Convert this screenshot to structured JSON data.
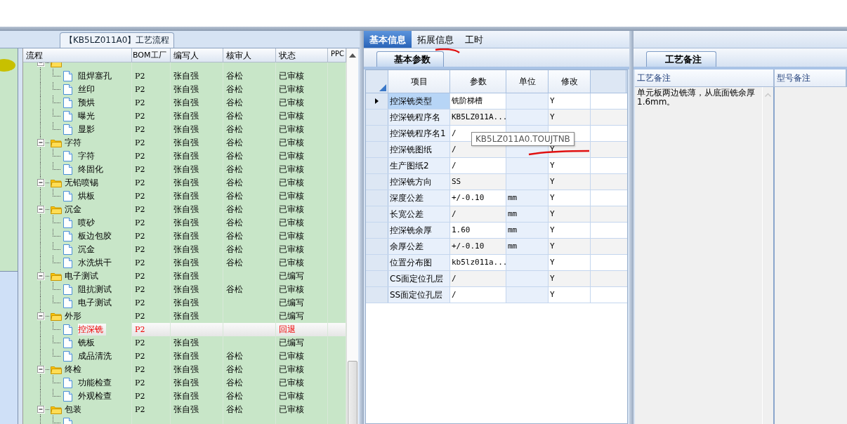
{
  "flow_panel": {
    "title": "【KB5LZ011A0】工艺流程",
    "columns": [
      "流程",
      "BOM工厂",
      "编写人",
      "核审人",
      "状态",
      "PPC"
    ],
    "tree": [
      {
        "selected": false,
        "children": [
          {
            "name": "阻焊塞孔",
            "bom": "P2",
            "writer": "张自强",
            "reviewer": "谷松",
            "status": "已审核",
            "selected": false
          },
          {
            "name": "丝印",
            "bom": "P2",
            "writer": "张自强",
            "reviewer": "谷松",
            "status": "已审核",
            "selected": false
          },
          {
            "name": "预烘",
            "bom": "P2",
            "writer": "张自强",
            "reviewer": "谷松",
            "status": "已审核",
            "selected": false
          },
          {
            "name": "曝光",
            "bom": "P2",
            "writer": "张自强",
            "reviewer": "谷松",
            "status": "已审核",
            "selected": false
          },
          {
            "name": "显影",
            "bom": "P2",
            "writer": "张自强",
            "reviewer": "谷松",
            "status": "已审核",
            "selected": false
          }
        ]
      },
      {
        "name": "字符",
        "bom": "P2",
        "writer": "张自强",
        "reviewer": "谷松",
        "status": "已审核",
        "selected": false,
        "children": [
          {
            "name": "字符",
            "bom": "P2",
            "writer": "张自强",
            "reviewer": "谷松",
            "status": "已审核",
            "selected": false
          },
          {
            "name": "终固化",
            "bom": "P2",
            "writer": "张自强",
            "reviewer": "谷松",
            "status": "已审核",
            "selected": false
          }
        ]
      },
      {
        "name": "无铅喷锡",
        "bom": "P2",
        "writer": "张自强",
        "reviewer": "谷松",
        "status": "已审核",
        "selected": false,
        "children": [
          {
            "name": "烘板",
            "bom": "P2",
            "writer": "张自强",
            "reviewer": "谷松",
            "status": "已审核",
            "selected": false
          }
        ]
      },
      {
        "name": "沉金",
        "bom": "P2",
        "writer": "张自强",
        "reviewer": "谷松",
        "status": "已审核",
        "selected": false,
        "children": [
          {
            "name": "喷砂",
            "bom": "P2",
            "writer": "张自强",
            "reviewer": "谷松",
            "status": "已审核",
            "selected": false
          },
          {
            "name": "板边包胶",
            "bom": "P2",
            "writer": "张自强",
            "reviewer": "谷松",
            "status": "已审核",
            "selected": false
          },
          {
            "name": "沉金",
            "bom": "P2",
            "writer": "张自强",
            "reviewer": "谷松",
            "status": "已审核",
            "selected": false
          },
          {
            "name": "水洗烘干",
            "bom": "P2",
            "writer": "张自强",
            "reviewer": "谷松",
            "status": "已审核",
            "selected": false
          }
        ]
      },
      {
        "name": "电子测试",
        "bom": "P2",
        "writer": "张自强",
        "status": "已编写",
        "selected": false,
        "children": [
          {
            "name": "阻抗测试",
            "bom": "P2",
            "writer": "张自强",
            "reviewer": "谷松",
            "status": "已审核",
            "selected": false
          },
          {
            "name": "电子测试",
            "bom": "P2",
            "writer": "张自强",
            "status": "已编写",
            "selected": false
          }
        ]
      },
      {
        "name": "外形",
        "bom": "P2",
        "writer": "张自强",
        "status": "已编写",
        "selected": false,
        "children": [
          {
            "name": "控深铣",
            "bom": "P2",
            "status": "回退",
            "selected": true
          },
          {
            "name": "铣板",
            "bom": "P2",
            "writer": "张自强",
            "status": "已编写",
            "selected": false
          },
          {
            "name": "成品清洗",
            "bom": "P2",
            "writer": "张自强",
            "reviewer": "谷松",
            "status": "已审核",
            "selected": false
          }
        ]
      },
      {
        "name": "终检",
        "bom": "P2",
        "writer": "张自强",
        "reviewer": "谷松",
        "status": "已审核",
        "selected": false,
        "children": [
          {
            "name": "功能检查",
            "bom": "P2",
            "writer": "张自强",
            "reviewer": "谷松",
            "status": "已审核",
            "selected": false
          },
          {
            "name": "外观检查",
            "bom": "P2",
            "writer": "张自强",
            "reviewer": "谷松",
            "status": "已审核",
            "selected": false
          }
        ]
      },
      {
        "name": "包装",
        "bom": "P2",
        "writer": "张自强",
        "reviewer": "谷松",
        "status": "已审核",
        "selected": false,
        "children": [
          {
            "selected": false
          }
        ]
      }
    ]
  },
  "tabs": [
    {
      "label": "基本信息",
      "selected": true
    },
    {
      "label": "拓展信息",
      "selected": false
    },
    {
      "label": "工时",
      "selected": false
    }
  ],
  "params_panel": {
    "tab": "基本参数",
    "columns": [
      "项目",
      "参数",
      "单位",
      "修改"
    ],
    "rows": [
      {
        "item": "控深铣类型",
        "value": "铣阶梯槽",
        "modify": "Y",
        "selected": true
      },
      {
        "item": "控深铣程序名",
        "value": "KB5LZ011A...",
        "modify": "Y",
        "selected": false
      },
      {
        "item": "控深铣程序名1",
        "value": "/",
        "selected": false
      },
      {
        "item": "控深铣图纸",
        "value": "/",
        "modify": "Y",
        "selected": false
      },
      {
        "item": "生产图纸2",
        "value": "/",
        "modify": "Y",
        "selected": false
      },
      {
        "item": "控深铣方向",
        "value": "SS",
        "modify": "Y",
        "selected": false
      },
      {
        "item": "深度公差",
        "value": "+/-0.10",
        "unit": "mm",
        "modify": "Y",
        "selected": false
      },
      {
        "item": "长宽公差",
        "value": "/",
        "unit": "mm",
        "modify": "Y",
        "selected": false
      },
      {
        "item": "控深铣余厚",
        "value": "1.60",
        "unit": "mm",
        "modify": "Y",
        "selected": false
      },
      {
        "item": "余厚公差",
        "value": "+/-0.10",
        "unit": "mm",
        "modify": "Y",
        "selected": false
      },
      {
        "item": "位置分布图",
        "value": "kb5lz011a...",
        "modify": "Y",
        "selected": false
      },
      {
        "item": "CS面定位孔层",
        "value": "/",
        "modify": "Y",
        "selected": false
      },
      {
        "item": "SS面定位孔层",
        "value": "/",
        "modify": "Y",
        "selected": false
      }
    ],
    "tooltip": "KB5LZ011A0.TOUJTNB"
  },
  "notes_panel": {
    "tab": "工艺备注",
    "columns": [
      "工艺备注",
      "型号备注"
    ],
    "process_note": "单元板两边铣薄，从底面铣余厚1.6mm。"
  }
}
